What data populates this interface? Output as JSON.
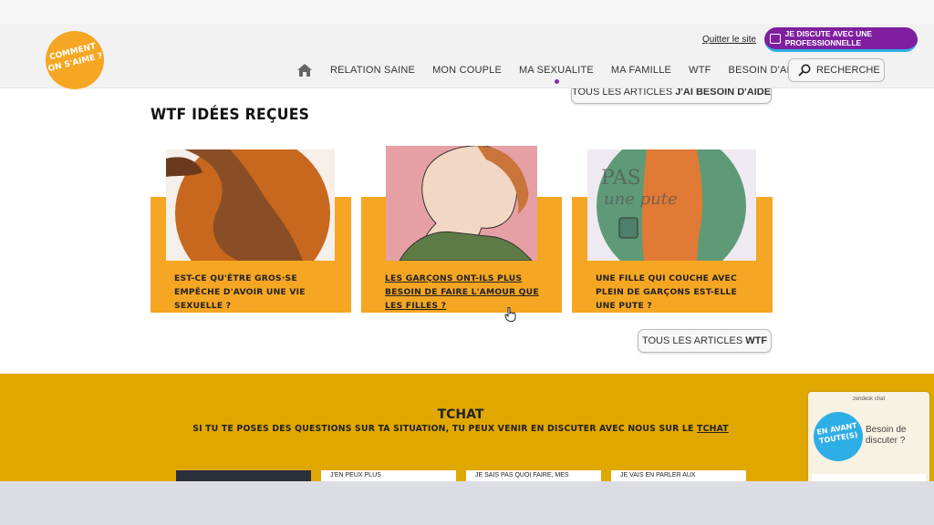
{
  "header": {
    "logo_text_line1": "COMMENT",
    "logo_text_line2": "ON S'AIME ?",
    "quit_link": "Quitter le site",
    "chat_pro_button": "JE DISCUTE AVEC UNE PROFESSIONNELLE",
    "nav": [
      "RELATION SAINE",
      "MON COUPLE",
      "MA SEXUALITE",
      "MA FAMILLE",
      "WTF",
      "BESOIN D'AIDE"
    ],
    "active_nav": "MA SEXUALITE",
    "search_label": "RECHERCHE"
  },
  "help_button": {
    "prefix": "TOUS LES ARTICLES",
    "bold": "J'AI BESOIN D'AIDE"
  },
  "section": {
    "title": "WTF IDÉES REÇUES",
    "cards": [
      {
        "caption": "EST-CE QU'ÊTRE GROS·SE EMPÊCHE D'AVOIR UNE VIE SEXUELLE ?"
      },
      {
        "caption": "LES GARÇONS ONT-ILS PLUS BESOIN DE FAIRE L'AMOUR QUE LES FILLES ?"
      },
      {
        "caption": "UNE FILLE QUI COUCHE AVEC PLEIN DE GARÇONS EST-ELLE UNE PUTE ?",
        "image_text_1": "PAS",
        "image_text_2": "une pute"
      }
    ],
    "more_button": {
      "prefix": "TOUS LES ARTICLES",
      "bold": "WTF"
    }
  },
  "tchat": {
    "title": "TCHAT",
    "subtitle": "SI TU TE POSES DES QUESTIONS SUR TA SITUATION, TU PEUX VENIR EN DISCUTER AVEC NOUS SUR LE",
    "subtitle_link": "TCHAT",
    "thumbs": [
      "",
      "J'EN PEUX PLUS",
      "JE SAIS PAS QUOI FAIRE, MES",
      "JE VAIS EN PARLER AUX"
    ]
  },
  "zendesk": {
    "brand": "zendesk chat",
    "badge_line1": "EN AVANT",
    "badge_line2": "TOUTE(S)",
    "text": "Besoin de discuter ?"
  },
  "colors": {
    "accent": "#f5a623",
    "purple": "#7f1f9f",
    "tchat_bg": "#e0a700",
    "blue": "#2eaee6"
  }
}
